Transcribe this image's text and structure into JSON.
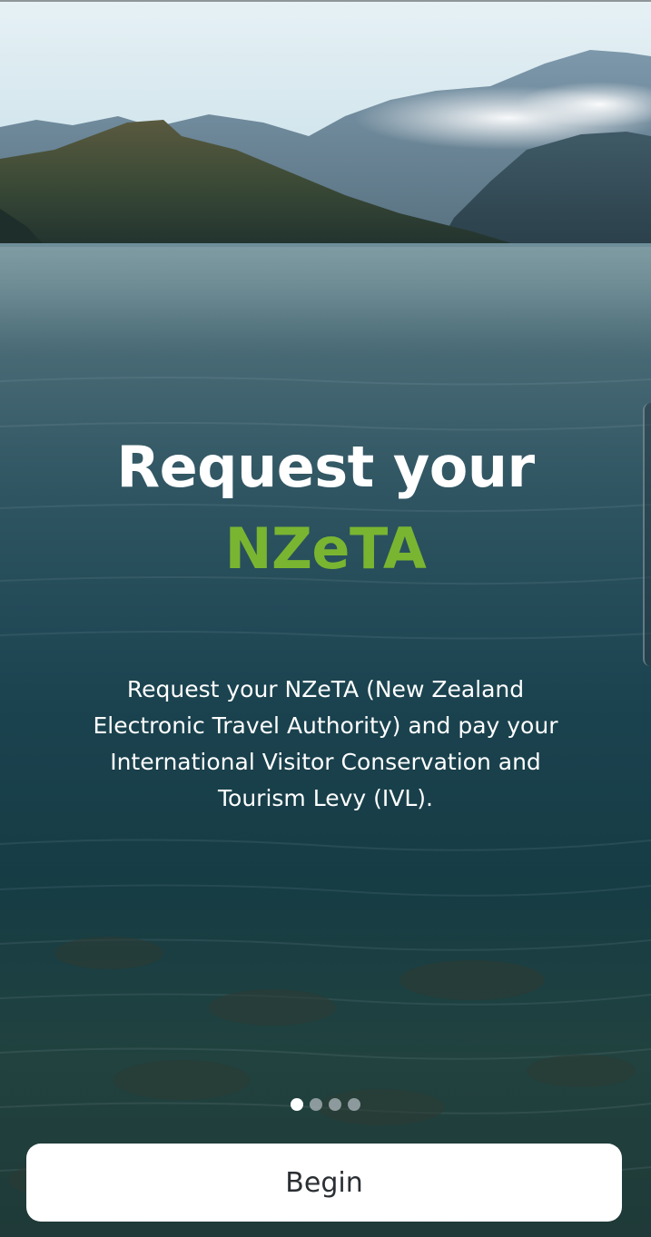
{
  "onboarding": {
    "headline_line1": "Request your",
    "headline_line2": "NZeTA",
    "description": "Request your NZeTA (New Zealand Electronic Travel Authority) and pay your International Visitor Conservation and Tourism Levy (IVL).",
    "pager": {
      "total_pages": 4,
      "current_page": 1
    },
    "begin_label": "Begin"
  },
  "colors": {
    "accent_green": "#7ab531",
    "headline_white": "#ffffff",
    "button_background": "#ffffff",
    "button_text": "#2b2f33"
  },
  "icons": {
    "background": "lake-mountains-image"
  }
}
